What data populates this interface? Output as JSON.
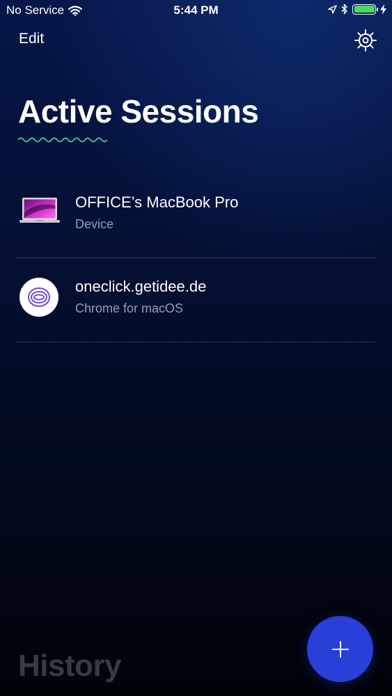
{
  "status_bar": {
    "carrier": "No Service",
    "time": "5:44 PM",
    "battery_color": "#4cd964"
  },
  "header": {
    "edit_label": "Edit",
    "settings_icon": "gear-icon"
  },
  "title": "Active Sessions",
  "sessions": [
    {
      "name": "OFFICE’s MacBook Pro",
      "subtitle": "Device",
      "icon": "laptop-icon"
    },
    {
      "name": "oneclick.getidee.de",
      "subtitle": "Chrome for macOS",
      "icon": "site-favicon-icon"
    }
  ],
  "history_label": "History",
  "fab": {
    "icon": "plus-icon",
    "color": "#2a3ed8"
  }
}
